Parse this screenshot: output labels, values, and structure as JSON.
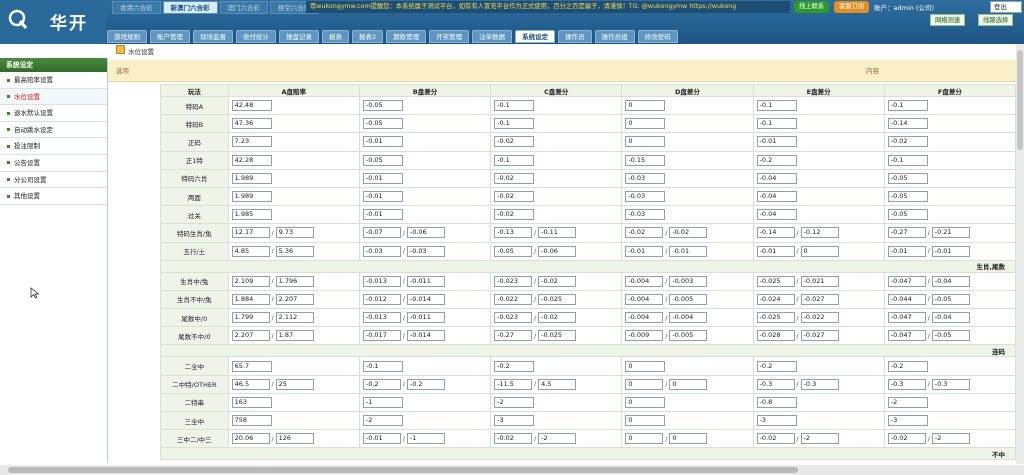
{
  "logo_text": "华开",
  "lottery_tabs": [
    "香港六合彩",
    "新澳门六合彩",
    "澳门六合彩",
    "極空六合彩"
  ],
  "lottery_active_index": 1,
  "notice": "尊wukongymw.com提醒您：本系统属于测试平台，如有有人冒充平台作为正式使用，百分之百是骗子，请谨慎！TG: @wukongymw https://wukong",
  "online_btn": "线上联系",
  "cs_btn": "客服订阅",
  "account": "账户：admin (公司)",
  "logout": "登出",
  "net_test": "网络测速",
  "line_select": "线路选择",
  "nav_tabs": [
    "游戏规则",
    "账户管理",
    "现场监督",
    "收付统计",
    "操盘记录",
    "报表",
    "报表2",
    "期数管理",
    "开奖管理",
    "注单数据",
    "系统设定",
    "操作员",
    "操作员组",
    "修改密码"
  ],
  "nav_active_index": 10,
  "breadcrumb": "水位设置",
  "sidebar": {
    "title": "系统设定",
    "items": [
      "最高赔率设置",
      "水位设置",
      "退水默认设置",
      "自动跳水设定",
      "投注限制",
      "公告设置",
      "分公司设置",
      "其他设置"
    ],
    "active_index": 1
  },
  "header": {
    "option": "选项",
    "content": "内容"
  },
  "columns": [
    "玩法",
    "A盘赔率",
    "B盘差分",
    "C盘差分",
    "D盘差分",
    "E盘差分",
    "F盘差分"
  ],
  "sections": [
    {
      "title": "",
      "rows": [
        {
          "label": "特码A",
          "cells": [
            [
              "42.48"
            ],
            [
              "-0.05"
            ],
            [
              "-0.1"
            ],
            [
              "0"
            ],
            [
              "-0.1"
            ],
            [
              "-0.1"
            ]
          ]
        },
        {
          "label": "特码B",
          "cells": [
            [
              "47.36"
            ],
            [
              "-0.05"
            ],
            [
              "-0.1"
            ],
            [
              "0"
            ],
            [
              "-0.1"
            ],
            [
              "-0.14"
            ]
          ]
        },
        {
          "label": "正码",
          "cells": [
            [
              "7.23"
            ],
            [
              "-0.01"
            ],
            [
              "-0.02"
            ],
            [
              "0"
            ],
            [
              "-0.01"
            ],
            [
              "-0.02"
            ]
          ]
        },
        {
          "label": "正1特",
          "cells": [
            [
              "42.28"
            ],
            [
              "-0.05"
            ],
            [
              "-0.1"
            ],
            [
              "-0.15"
            ],
            [
              "-0.2"
            ],
            [
              "-0.1"
            ]
          ]
        },
        {
          "label": "特码六肖",
          "cells": [
            [
              "1.989"
            ],
            [
              "-0.01"
            ],
            [
              "-0.02"
            ],
            [
              "-0.03"
            ],
            [
              "-0.04"
            ],
            [
              "-0.05"
            ]
          ]
        },
        {
          "label": "两面",
          "cells": [
            [
              "1.989"
            ],
            [
              "-0.01"
            ],
            [
              "-0.02"
            ],
            [
              "-0.03"
            ],
            [
              "-0.04"
            ],
            [
              "-0.05"
            ]
          ]
        },
        {
          "label": "过关",
          "cells": [
            [
              "1.985"
            ],
            [
              "-0.01"
            ],
            [
              "-0.02"
            ],
            [
              "-0.03"
            ],
            [
              "-0.04"
            ],
            [
              "-0.05"
            ]
          ]
        },
        {
          "label": "特码生肖/兔",
          "cells": [
            [
              "12.17",
              "9.73"
            ],
            [
              "-0.07",
              "-0.06"
            ],
            [
              "-0.13",
              "-0.11"
            ],
            [
              "-0.02",
              "-0.02"
            ],
            [
              "-0.14",
              "-0.12"
            ],
            [
              "-0.27",
              "-0.21"
            ]
          ]
        },
        {
          "label": "五行/土",
          "cells": [
            [
              "4.85",
              "5.36"
            ],
            [
              "-0.03",
              "-0.03"
            ],
            [
              "-0.05",
              "-0.06"
            ],
            [
              "-0.01",
              "-0.01"
            ],
            [
              "-0.01",
              "0"
            ],
            [
              "-0.01",
              "-0.01"
            ]
          ]
        }
      ]
    },
    {
      "title": "生肖,尾数",
      "rows": [
        {
          "label": "生肖中/兔",
          "cells": [
            [
              "2.109",
              "1.796"
            ],
            [
              "-0.013",
              "-0.011"
            ],
            [
              "-0.023",
              "-0.02"
            ],
            [
              "-0.004",
              "-0.003"
            ],
            [
              "-0.025",
              "-0.021"
            ],
            [
              "-0.047",
              "-0.04"
            ]
          ]
        },
        {
          "label": "生肖不中/兔",
          "cells": [
            [
              "1.884",
              "2.207"
            ],
            [
              "-0.012",
              "-0.014"
            ],
            [
              "-0.022",
              "-0.025"
            ],
            [
              "-0.004",
              "-0.005"
            ],
            [
              "-0.024",
              "-0.027"
            ],
            [
              "-0.044",
              "-0.05"
            ]
          ]
        },
        {
          "label": "尾数中/0",
          "cells": [
            [
              "1.799",
              "2.112"
            ],
            [
              "-0.013",
              "-0.011"
            ],
            [
              "-0.023",
              "-0.02"
            ],
            [
              "-0.004",
              "-0.004"
            ],
            [
              "-0.025",
              "-0.022"
            ],
            [
              "-0.047",
              "-0.04"
            ]
          ]
        },
        {
          "label": "尾数不中/0",
          "cells": [
            [
              "2.207",
              "1.87"
            ],
            [
              "-0.017",
              "-0.014"
            ],
            [
              "-0.27",
              "-0.025"
            ],
            [
              "-0.009",
              "-0.005"
            ],
            [
              "-0.028",
              "-0.027"
            ],
            [
              "-0.047",
              "-0.05"
            ]
          ]
        }
      ]
    },
    {
      "title": "连码",
      "rows": [
        {
          "label": "二全中",
          "cells": [
            [
              "65.7"
            ],
            [
              "-0.1"
            ],
            [
              "-0.2"
            ],
            [
              "0"
            ],
            [
              "-0.2"
            ],
            [
              "-0.2"
            ]
          ]
        },
        {
          "label": "二中特/OTHER",
          "cells": [
            [
              "46.5",
              "25"
            ],
            [
              "-0.2",
              "-0.2"
            ],
            [
              "-11.5",
              "4.5"
            ],
            [
              "0",
              "0"
            ],
            [
              "-0.3",
              "-0.3"
            ],
            [
              "-0.3",
              "-0.3"
            ]
          ]
        },
        {
          "label": "二特串",
          "cells": [
            [
              "163"
            ],
            [
              "-1"
            ],
            [
              "-2"
            ],
            [
              "0"
            ],
            [
              "-0.8"
            ],
            [
              "-2"
            ]
          ]
        },
        {
          "label": "三全中",
          "cells": [
            [
              "758"
            ],
            [
              "-2"
            ],
            [
              "-3"
            ],
            [
              "0"
            ],
            [
              "-3"
            ],
            [
              "-3"
            ]
          ]
        },
        {
          "label": "三中二/中三",
          "cells": [
            [
              "20.06",
              "126"
            ],
            [
              "-0.01",
              "-1"
            ],
            [
              "-0.02",
              "-2"
            ],
            [
              "0",
              "0"
            ],
            [
              "-0.02",
              "-2"
            ],
            [
              "-0.02",
              "-2"
            ]
          ]
        }
      ]
    },
    {
      "title": "不中",
      "rows": []
    }
  ]
}
